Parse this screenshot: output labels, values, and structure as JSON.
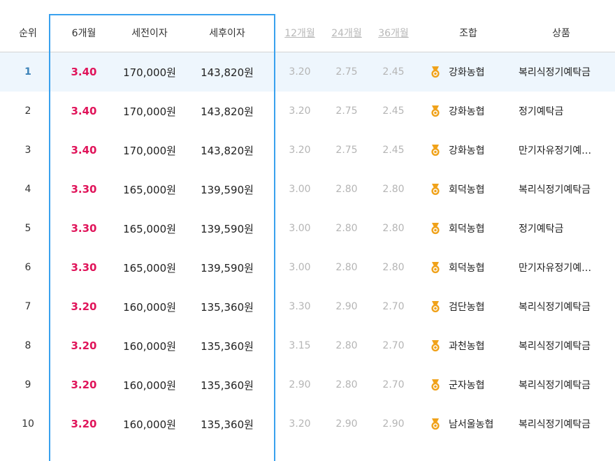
{
  "header": {
    "rank": "순위",
    "m6": "6개월",
    "pre_tax": "세전이자",
    "post_tax": "세후이자",
    "m12": "12개월",
    "m24": "24개월",
    "m36": "36개월",
    "union": "조합",
    "product": "상품"
  },
  "colors": {
    "accent": "#39a1ee",
    "rate": "#e0145a",
    "muted": "#b5b5b5",
    "medal": "#f0a21a"
  },
  "rows": [
    {
      "rank": "1",
      "m6": "3.40",
      "pre": "170,000원",
      "post": "143,820원",
      "m12": "3.20",
      "m24": "2.75",
      "m36": "2.45",
      "union": "강화농협",
      "product": "복리식정기예탁금"
    },
    {
      "rank": "2",
      "m6": "3.40",
      "pre": "170,000원",
      "post": "143,820원",
      "m12": "3.20",
      "m24": "2.75",
      "m36": "2.45",
      "union": "강화농협",
      "product": "정기예탁금"
    },
    {
      "rank": "3",
      "m6": "3.40",
      "pre": "170,000원",
      "post": "143,820원",
      "m12": "3.20",
      "m24": "2.75",
      "m36": "2.45",
      "union": "강화농협",
      "product": "만기자유정기예…"
    },
    {
      "rank": "4",
      "m6": "3.30",
      "pre": "165,000원",
      "post": "139,590원",
      "m12": "3.00",
      "m24": "2.80",
      "m36": "2.80",
      "union": "회덕농협",
      "product": "복리식정기예탁금"
    },
    {
      "rank": "5",
      "m6": "3.30",
      "pre": "165,000원",
      "post": "139,590원",
      "m12": "3.00",
      "m24": "2.80",
      "m36": "2.80",
      "union": "회덕농협",
      "product": "정기예탁금"
    },
    {
      "rank": "6",
      "m6": "3.30",
      "pre": "165,000원",
      "post": "139,590원",
      "m12": "3.00",
      "m24": "2.80",
      "m36": "2.80",
      "union": "회덕농협",
      "product": "만기자유정기예…"
    },
    {
      "rank": "7",
      "m6": "3.20",
      "pre": "160,000원",
      "post": "135,360원",
      "m12": "3.30",
      "m24": "2.90",
      "m36": "2.70",
      "union": "검단농협",
      "product": "복리식정기예탁금"
    },
    {
      "rank": "8",
      "m6": "3.20",
      "pre": "160,000원",
      "post": "135,360원",
      "m12": "3.15",
      "m24": "2.80",
      "m36": "2.70",
      "union": "과천농협",
      "product": "복리식정기예탁금"
    },
    {
      "rank": "9",
      "m6": "3.20",
      "pre": "160,000원",
      "post": "135,360원",
      "m12": "2.90",
      "m24": "2.80",
      "m36": "2.70",
      "union": "군자농협",
      "product": "복리식정기예탁금"
    },
    {
      "rank": "10",
      "m6": "3.20",
      "pre": "160,000원",
      "post": "135,360원",
      "m12": "3.20",
      "m24": "2.90",
      "m36": "2.90",
      "union": "남서울농협",
      "product": "복리식정기예탁금"
    }
  ]
}
